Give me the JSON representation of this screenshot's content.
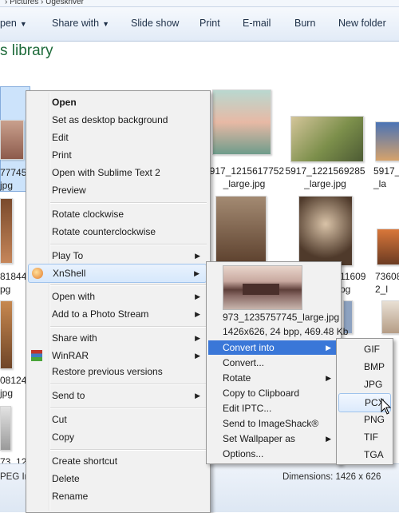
{
  "breadcrumb": {
    "text": "› Pictures › Ugeskriver"
  },
  "toolbar": {
    "open": "pen",
    "share_with": "Share with",
    "slide_show": "Slide show",
    "print": "Print",
    "email": "E-mail",
    "burn": "Burn",
    "new_folder": "New folder"
  },
  "library_title": "s library",
  "thumbnails": {
    "top_row": [
      {
        "line1": "77745_l",
        "line2": "jpg"
      },
      {
        "line1": "5917_1215617752",
        "line2": "_large.jpg"
      },
      {
        "line1": "5917_1221569285",
        "line2": "_large.jpg"
      },
      {
        "line1": "5917_",
        "line2": "_la"
      }
    ],
    "row2": [
      {
        "line1": "81844",
        "line2": "pg"
      },
      {
        "line1": "11609",
        "line2": "pg"
      },
      {
        "line1": "73608",
        "line2": "2_l"
      }
    ],
    "row3": [
      {
        "line1": "08124",
        "line2": "jpg"
      },
      {
        "line1": "73_12",
        "line2": ""
      }
    ]
  },
  "status": {
    "left": "PEG Im",
    "frag": "g",
    "dimensions": "Dimensions: 1426 x 626"
  },
  "context_menu": {
    "items": [
      "Open",
      "Set as desktop background",
      "Edit",
      "Print",
      "Open with Sublime Text 2",
      "Preview",
      "Rotate clockwise",
      "Rotate counterclockwise",
      "Play To",
      "XnShell",
      "Open with",
      "Add to a Photo Stream",
      "Share with",
      "WinRAR",
      "Restore previous versions",
      "Send to",
      "Cut",
      "Copy",
      "Create shortcut",
      "Delete",
      "Rename"
    ]
  },
  "xnshell": {
    "filename": "973_1235757745_large.jpg",
    "info": "1426x626, 24 bpp, 469.48 Kb",
    "items": [
      "Convert into",
      "Convert...",
      "Rotate",
      "Copy to Clipboard",
      "Edit IPTC...",
      "Send to ImageShack®",
      "Set Wallpaper as",
      "Options..."
    ]
  },
  "convert_formats": [
    "GIF",
    "BMP",
    "JPG",
    "PCX",
    "PNG",
    "TIF",
    "TGA"
  ],
  "colors": {
    "highlight": "#3a77d8",
    "menu_bg": "#f1f1f1",
    "title_green": "#1e6b3a"
  }
}
